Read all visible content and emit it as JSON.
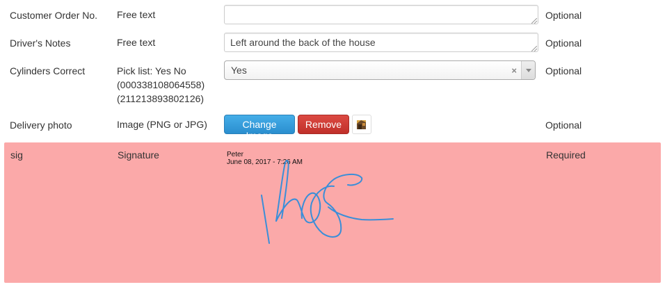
{
  "fields": [
    {
      "name": "Customer Order No.",
      "type": "Free text",
      "value": "",
      "status": "Optional"
    },
    {
      "name": "Driver's Notes",
      "type": "Free text",
      "value": "Left around the back of the house",
      "status": "Optional"
    },
    {
      "name": "Cylinders Correct",
      "type_lines": [
        "Pick list: Yes No",
        "(000338108064558)",
        "(211213893802126)"
      ],
      "selected": "Yes",
      "clear_glyph": "×",
      "status": "Optional"
    },
    {
      "name": "Delivery photo",
      "type": "Image (PNG or JPG)",
      "change_label": "Change Image",
      "remove_label": "Remove",
      "thumbnail_icon": "image-thumbnail-icon",
      "status": "Optional"
    }
  ],
  "signature": {
    "name": "sig",
    "type": "Signature",
    "signer": "Peter",
    "date": "June 08, 2017 - 7:26 AM",
    "status": "Required",
    "stroke_color": "#3a8ed8",
    "panel_color": "#fba9a9"
  },
  "colors": {
    "primary_button": "#2a8ecf",
    "danger_button": "#c0302a"
  }
}
